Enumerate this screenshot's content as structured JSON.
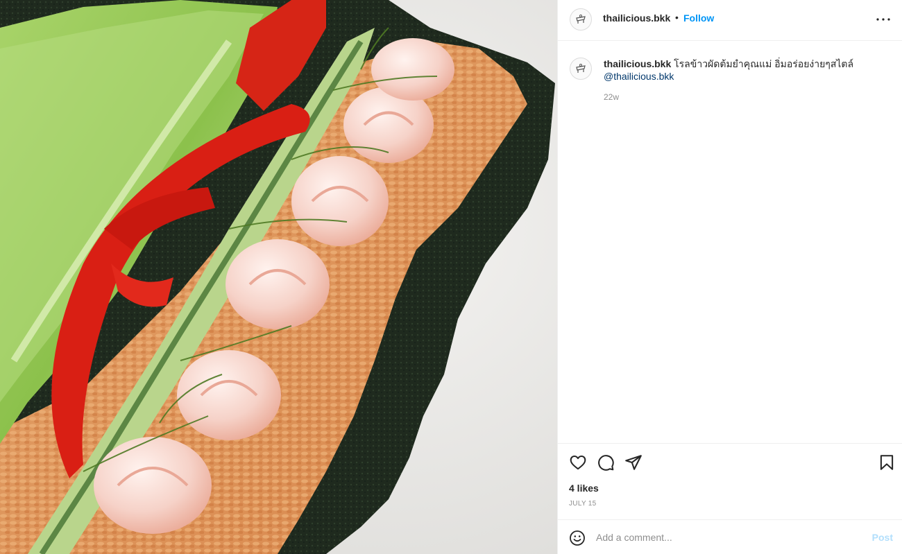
{
  "post": {
    "image_alt": "Seaweed roll with fried rice, shrimp, lettuce, red pepper and cucumber"
  },
  "header": {
    "username": "thailicious.bkk",
    "separator": "•",
    "follow_label": "Follow"
  },
  "caption": {
    "username": "thailicious.bkk",
    "text": "โรลข้าวผัดต้มยำคุณแม่ อิ่มอร่อยง่ายๆสไตล์",
    "mention": "@thailicious.bkk",
    "time_ago": "22w"
  },
  "actions": {
    "likes": "4 likes",
    "date": "JULY 15",
    "icons": [
      "heart-icon",
      "comment-icon",
      "share-icon",
      "bookmark-icon"
    ]
  },
  "comment": {
    "placeholder": "Add a comment...",
    "post_label": "Post"
  },
  "colors": {
    "link_blue": "#0095f6",
    "mention": "#00376b",
    "muted": "#8e8e8e",
    "post_disabled": "#b2dffc"
  }
}
